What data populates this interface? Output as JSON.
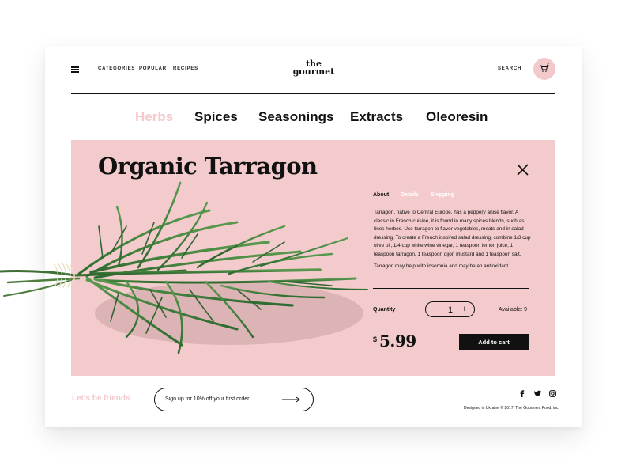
{
  "header": {
    "nav": [
      "CATEGORIES",
      "POPULAR",
      "RECIPES"
    ],
    "logo_line1": "the",
    "logo_line2": "gourmet",
    "search_label": "SEARCH",
    "cart_count": "2"
  },
  "categories": [
    "Herbs",
    "Spices",
    "Seasonings",
    "Extracts",
    "Oleoresin"
  ],
  "active_category": "Herbs",
  "product": {
    "title": "Organic Tarragon",
    "tabs": [
      "About",
      "Details",
      "Shipping"
    ],
    "description": "Tarragon, native to Central Europe, has a peppery anise flavor. A classic in French cuisine, it is found in many spices blends, such as fines herbes. Use tarragon to flavor vegetables, meats and in salad dressing. To create a French inspired salad dressing, combine 1/3 cup olive oil, 1/4 cup white wine vinegar, 1 teaspoon lemon juice, 1 teaspoon tarragon, 1 teaspoon dijon mustard and 1 teaspoon salt.",
    "note": "Tarragon may help with insomnia and may be an antioxidant.",
    "quantity_label": "Quantity",
    "quantity": "1",
    "availability": "Available: 9",
    "currency": "$",
    "price": "5.99",
    "add_to_cart": "Add to cart"
  },
  "footer": {
    "friends": "Let's be friends",
    "signup": "Sign up for 10% off your first order",
    "credit": "Designed in Ukraine © 2017, The Gourment Food, inc",
    "social_icons": [
      "facebook-icon",
      "twitter-icon",
      "instagram-icon"
    ]
  },
  "colors": {
    "accent_pink": "#f3c9cb",
    "panel_pink": "#f3cbcd",
    "text": "#111111"
  }
}
